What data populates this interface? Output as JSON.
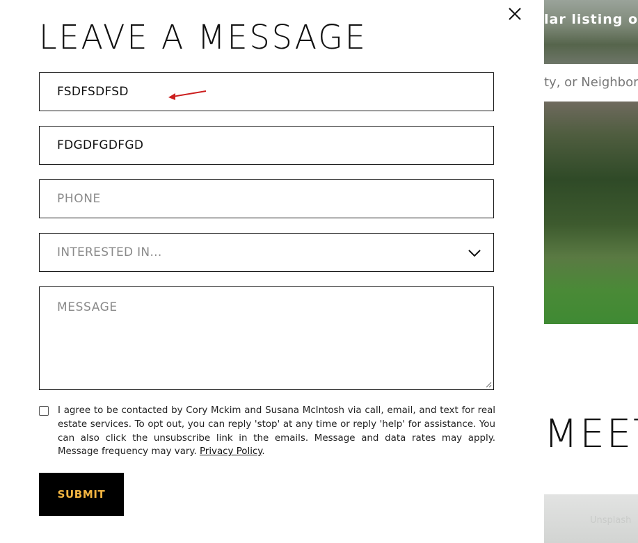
{
  "modal": {
    "title": "LEAVE A MESSAGE",
    "close_icon": "close-icon",
    "fields": {
      "first_name": {
        "value": "FSDFSDFSD"
      },
      "last_name": {
        "value": "FDGDFGDFGD"
      },
      "phone": {
        "placeholder": "PHONE"
      },
      "interested_in": {
        "selected": "INTERESTED IN...",
        "icon": "chevron-down-icon"
      },
      "message": {
        "placeholder": "MESSAGE"
      }
    },
    "consent": {
      "text": "I agree to be contacted by Cory Mckim and Susana McIntosh via call, email, and text for real estate services. To opt out, you can reply 'stop' at any time or reply 'help' for assistance. You can also click the unsubscribe link in the emails. Message and data rates may apply. Message frequency may vary.",
      "link_label": "Privacy Policy",
      "checked": false
    },
    "submit_label": "SUBMIT",
    "colors": {
      "submit_bg": "#000000",
      "submit_text": "#f3b541",
      "annotation_arrow": "#cc1f1f"
    }
  },
  "background": {
    "banner_text": "lar listing or",
    "search_hint": "ty, or Neighbor",
    "section_heading": "MEET",
    "photo_credit": "Unsplash"
  }
}
